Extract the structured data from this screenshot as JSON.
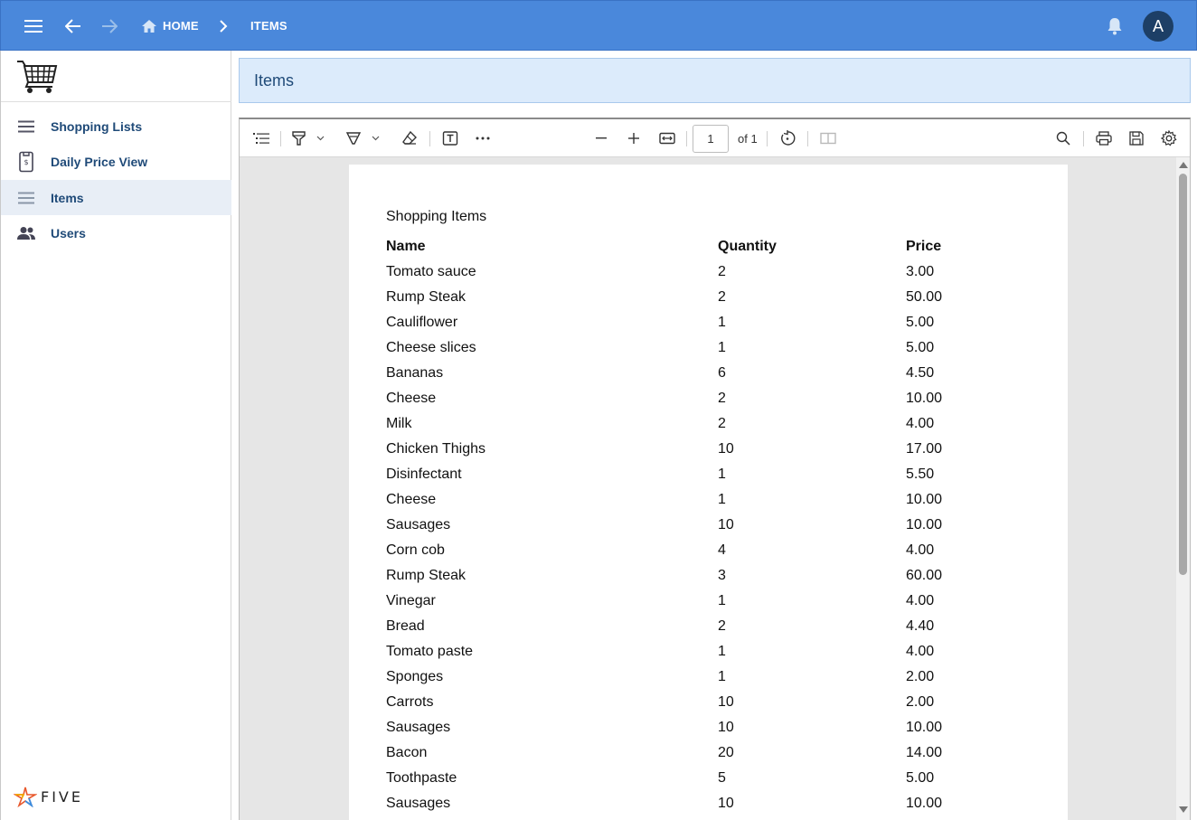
{
  "header": {
    "breadcrumb": [
      {
        "label": "HOME",
        "icon": "home-icon"
      },
      {
        "label": "ITEMS"
      }
    ],
    "avatar_initial": "A",
    "colors": {
      "appbar": "#4a88db",
      "avatar": "#1d3f66"
    }
  },
  "sidebar": {
    "items": [
      {
        "label": "Shopping Lists",
        "icon": "list-icon",
        "active": false
      },
      {
        "label": "Daily Price View",
        "icon": "price-tag-icon",
        "active": false
      },
      {
        "label": "Items",
        "icon": "list-icon",
        "active": true
      },
      {
        "label": "Users",
        "icon": "users-icon",
        "active": false
      }
    ],
    "brand": "FIVE"
  },
  "page": {
    "title": "Items"
  },
  "viewer": {
    "page_number": "1",
    "page_total_label": "of 1",
    "document": {
      "title": "Shopping Items",
      "columns": [
        "Name",
        "Quantity",
        "Price"
      ],
      "rows": [
        [
          "Tomato sauce",
          "2",
          "3.00"
        ],
        [
          "Rump Steak",
          "2",
          "50.00"
        ],
        [
          "Cauliflower",
          "1",
          "5.00"
        ],
        [
          "Cheese slices",
          "1",
          "5.00"
        ],
        [
          "Bananas",
          "6",
          "4.50"
        ],
        [
          "Cheese",
          "2",
          "10.00"
        ],
        [
          "Milk",
          "2",
          "4.00"
        ],
        [
          "Chicken Thighs",
          "10",
          "17.00"
        ],
        [
          "Disinfectant",
          "1",
          "5.50"
        ],
        [
          "Cheese",
          "1",
          "10.00"
        ],
        [
          "Sausages",
          "10",
          "10.00"
        ],
        [
          "Corn cob",
          "4",
          "4.00"
        ],
        [
          "Rump Steak",
          "3",
          "60.00"
        ],
        [
          "Vinegar",
          "1",
          "4.00"
        ],
        [
          "Bread",
          "2",
          "4.40"
        ],
        [
          "Tomato paste",
          "1",
          "4.00"
        ],
        [
          "Sponges",
          "1",
          "2.00"
        ],
        [
          "Carrots",
          "10",
          "2.00"
        ],
        [
          "Sausages",
          "10",
          "10.00"
        ],
        [
          "Bacon",
          "20",
          "14.00"
        ],
        [
          "Toothpaste",
          "5",
          "5.00"
        ],
        [
          "Sausages",
          "10",
          "10.00"
        ]
      ]
    }
  }
}
